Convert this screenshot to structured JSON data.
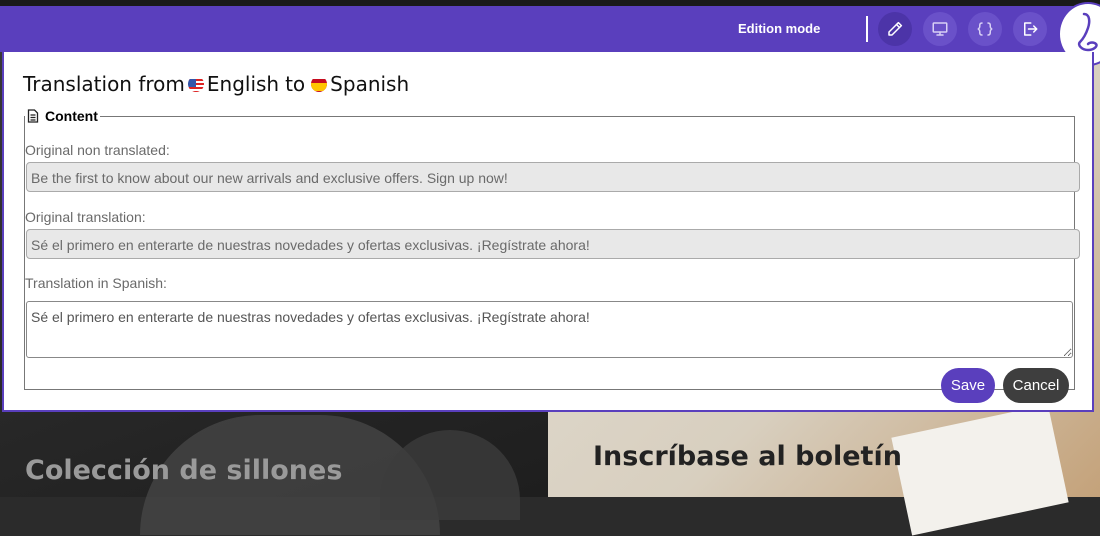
{
  "toolbar": {
    "mode_label": "Edition mode",
    "buttons": [
      {
        "icon": "pencil-icon"
      },
      {
        "icon": "monitor-icon"
      },
      {
        "icon": "braces-icon"
      },
      {
        "icon": "logout-icon"
      }
    ],
    "accent": "#5a3fbd"
  },
  "dialog": {
    "title_prefix": "Translation from",
    "source_language": "English",
    "title_middle": "to",
    "target_language": "Spanish",
    "section_legend": "Content",
    "original_label": "Original non translated:",
    "original_value": "Be the first to know about our new arrivals and exclusive offers. Sign up now!",
    "original_translation_label": "Original translation:",
    "original_translation_value": "Sé el primero en enterarte de nuestras novedades y ofertas exclusivas. ¡Regístrate ahora!",
    "translation_label": "Translation in Spanish:",
    "translation_value": "Sé el primero en enterarte de nuestras novedades y ofertas exclusivas. ¡Regístrate ahora!",
    "save_label": "Save",
    "cancel_label": "Cancel"
  },
  "background": {
    "left_title": "Colección de sillones",
    "right_title": "Inscríbase al boletín"
  }
}
